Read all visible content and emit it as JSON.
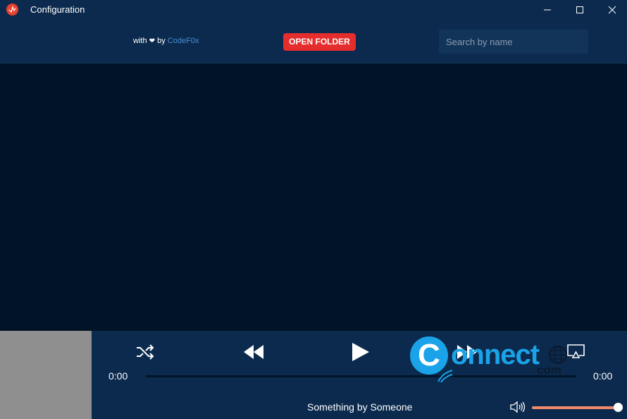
{
  "window": {
    "title": "Configuration"
  },
  "header": {
    "credit_prefix": "with",
    "credit_heart": "❤",
    "credit_by": "by",
    "credit_author": "CodeF0x",
    "open_folder_label": "OPEN FOLDER",
    "search_placeholder": "Search by name",
    "search_value": ""
  },
  "player": {
    "time_current": "0:00",
    "time_total": "0:00",
    "progress_fraction": 0,
    "now_playing": "Something by Someone",
    "volume_fraction": 1.0
  },
  "watermark": {
    "letter": "C",
    "text": "onnect",
    "suffix": "com"
  },
  "colors": {
    "accent": "#e52d2d",
    "progress": "#f08a6a",
    "background": "#011327",
    "panel": "#0b2a4e"
  },
  "icons": {
    "app": "app-logo-icon",
    "minimize": "minimize-icon",
    "maximize": "maximize-icon",
    "close": "close-icon",
    "shuffle": "shuffle-icon",
    "rewind": "rewind-icon",
    "play": "play-icon",
    "forward": "fast-forward-icon",
    "cast": "cast-icon",
    "volume": "volume-icon"
  }
}
